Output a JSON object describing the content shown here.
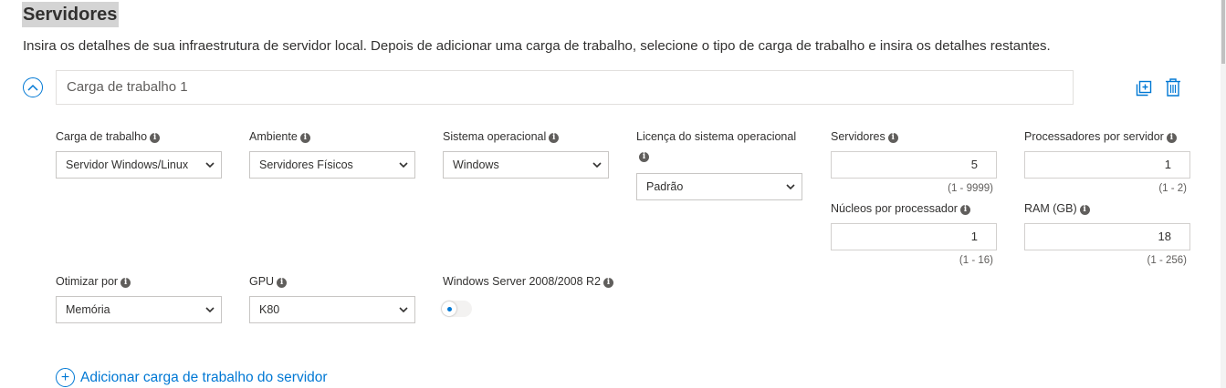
{
  "section": {
    "title": "Servidores",
    "description": "Insira os detalhes de sua infraestrutura de servidor local. Depois de adicionar uma carga de trabalho, selecione o tipo de carga de trabalho e insira os detalhes restantes."
  },
  "workload": {
    "name": "Carga de trabalho 1",
    "fields": {
      "workload_type": {
        "label": "Carga de trabalho",
        "value": "Servidor Windows/Linux"
      },
      "environment": {
        "label": "Ambiente",
        "value": "Servidores Físicos"
      },
      "os": {
        "label": "Sistema operacional",
        "value": "Windows"
      },
      "os_license": {
        "label": "Licença do sistema operacional",
        "value": "Padrão"
      },
      "servers": {
        "label": "Servidores",
        "value": "5",
        "range": "(1 - 9999)"
      },
      "processors": {
        "label": "Processadores por servidor",
        "value": "1",
        "range": "(1 - 2)"
      },
      "cores": {
        "label": "Núcleos por processador",
        "value": "1",
        "range": "(1 - 16)"
      },
      "ram": {
        "label": "RAM (GB)",
        "value": "18",
        "range": "(1 - 256)"
      },
      "optimize_by": {
        "label": "Otimizar por",
        "value": "Memória"
      },
      "gpu": {
        "label": "GPU",
        "value": "K80"
      },
      "windows_2008": {
        "label": "Windows Server 2008/2008 R2",
        "enabled": false
      }
    }
  },
  "actions": {
    "add_workload": "Adicionar carga de trabalho do servidor"
  },
  "icons": {
    "collapse": "chevron-up-icon",
    "duplicate": "duplicate-icon",
    "delete": "trash-icon",
    "info": "info-icon",
    "dropdown": "chevron-down-icon",
    "add": "plus-circle-icon"
  },
  "colors": {
    "accent": "#0078d4",
    "text": "#323130",
    "border": "#c8c6c4"
  }
}
